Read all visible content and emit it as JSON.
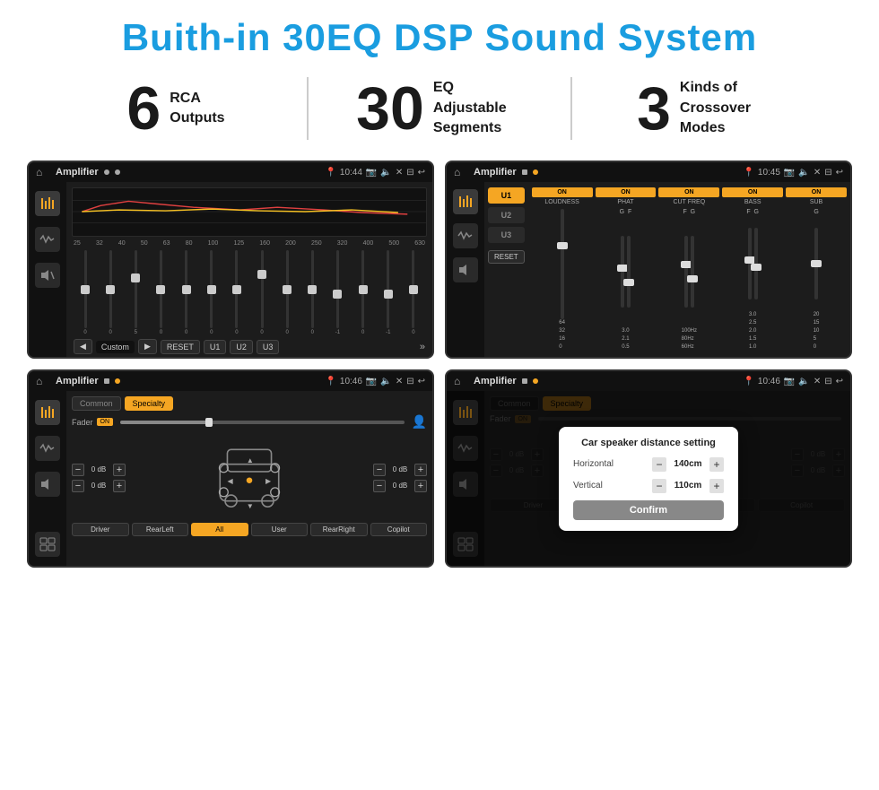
{
  "page": {
    "title": "Buith-in 30EQ DSP Sound System",
    "background": "#ffffff"
  },
  "stats": [
    {
      "number": "6",
      "label": "RCA\nOutputs"
    },
    {
      "number": "30",
      "label": "EQ Adjustable\nSegments"
    },
    {
      "number": "3",
      "label": "Kinds of\nCrossover Modes"
    }
  ],
  "screen1": {
    "title": "Amplifier",
    "time": "10:44",
    "frequencies": [
      "25",
      "32",
      "40",
      "50",
      "63",
      "80",
      "100",
      "125",
      "160",
      "200",
      "250",
      "320",
      "400",
      "500",
      "630"
    ],
    "values": [
      "0",
      "0",
      "0",
      "5",
      "0",
      "0",
      "0",
      "0",
      "0",
      "0",
      "0",
      "-1",
      "0",
      "-1"
    ],
    "preset": "Custom",
    "buttons": [
      "RESET",
      "U1",
      "U2",
      "U3"
    ]
  },
  "screen2": {
    "title": "Amplifier",
    "time": "10:45",
    "presets": [
      "U1",
      "U2",
      "U3"
    ],
    "channels": [
      {
        "name": "LOUDNESS",
        "on": true
      },
      {
        "name": "PHAT",
        "on": true
      },
      {
        "name": "CUT FREQ",
        "on": true
      },
      {
        "name": "BASS",
        "on": true
      },
      {
        "name": "SUB",
        "on": true
      }
    ],
    "resetBtn": "RESET"
  },
  "screen3": {
    "title": "Amplifier",
    "time": "10:46",
    "tabs": [
      "Common",
      "Specialty"
    ],
    "activeTab": "Specialty",
    "fader": "Fader",
    "faderOn": "ON",
    "controls": [
      {
        "label": "0 dB"
      },
      {
        "label": "0 dB"
      },
      {
        "label": "0 dB"
      },
      {
        "label": "0 dB"
      }
    ],
    "buttons": [
      "Driver",
      "RearLeft",
      "All",
      "User",
      "RearRight",
      "Copilot"
    ]
  },
  "screen4": {
    "title": "Amplifier",
    "time": "10:46",
    "tabs": [
      "Common",
      "Specialty"
    ],
    "dialog": {
      "title": "Car speaker distance setting",
      "horizontal_label": "Horizontal",
      "horizontal_value": "140cm",
      "vertical_label": "Vertical",
      "vertical_value": "110cm",
      "confirm_label": "Confirm"
    },
    "controls": [
      {
        "label": "0 dB"
      },
      {
        "label": "0 dB"
      }
    ],
    "buttons": [
      "Driver",
      "RearLeft",
      "All",
      "User",
      "RearRight",
      "Copilot"
    ]
  }
}
